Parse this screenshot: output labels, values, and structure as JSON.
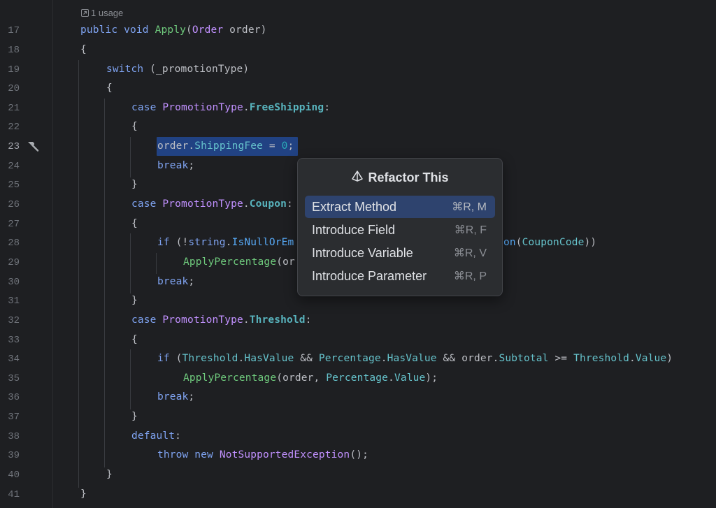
{
  "usage_hint": "1 usage",
  "lines": [
    {
      "n": "17"
    },
    {
      "n": "18"
    },
    {
      "n": "19"
    },
    {
      "n": "20"
    },
    {
      "n": "21"
    },
    {
      "n": "22"
    },
    {
      "n": "23"
    },
    {
      "n": "24"
    },
    {
      "n": "25"
    },
    {
      "n": "26"
    },
    {
      "n": "27"
    },
    {
      "n": "28"
    },
    {
      "n": "29"
    },
    {
      "n": "30"
    },
    {
      "n": "31"
    },
    {
      "n": "32"
    },
    {
      "n": "33"
    },
    {
      "n": "34"
    },
    {
      "n": "35"
    },
    {
      "n": "36"
    },
    {
      "n": "37"
    },
    {
      "n": "38"
    },
    {
      "n": "39"
    },
    {
      "n": "40"
    },
    {
      "n": "41"
    }
  ],
  "code": {
    "l17": {
      "kw1": "public",
      "kw2": "void",
      "method": "Apply",
      "paren_open": "(",
      "type": "Order",
      "param": " order)"
    },
    "l18": "{",
    "l19": {
      "kw": "switch",
      "rest": " (_promotionType)"
    },
    "l20": "{",
    "l21": {
      "kw": "case",
      "type": "PromotionType",
      "dot": ".",
      "member": "FreeShipping",
      "colon": ":"
    },
    "l22": "{",
    "l23": {
      "obj": "order",
      "dot": ".",
      "prop": "ShippingFee",
      "eq": " = ",
      "num": "0",
      "semi": ";"
    },
    "l24": {
      "kw": "break",
      "semi": ";"
    },
    "l25": "}",
    "l26": {
      "kw": "case",
      "type": "PromotionType",
      "dot": ".",
      "member": "Coupon",
      "colon": ":"
    },
    "l27": "{",
    "l28": {
      "kw": "if",
      "p1": " (!",
      "kw2": "string",
      "dot": ".",
      "method": "IsNullOrEm",
      "tail_method": "on",
      "tail_open": "(",
      "tail_prop": "CouponCode",
      "tail_close": "))"
    },
    "l29": {
      "method": "ApplyPercentage",
      "rest": "(or"
    },
    "l30": {
      "kw": "break",
      "semi": ";"
    },
    "l31": "}",
    "l32": {
      "kw": "case",
      "type": "PromotionType",
      "dot": ".",
      "member": "Threshold",
      "colon": ":"
    },
    "l33": "{",
    "l34": {
      "kw": "if",
      "p1": " (",
      "a": "Threshold",
      "d1": ".",
      "b": "HasValue",
      "and1": " && ",
      "c": "Percentage",
      "d2": ".",
      "e": "HasValue",
      "and2": " && ",
      "f": "order",
      "d3": ".",
      "g": "Subtotal",
      "ge": " >= ",
      "h": "Threshold",
      "d4": ".",
      "i": "Value",
      "close": ")"
    },
    "l35": {
      "method": "ApplyPercentage",
      "open": "(order, ",
      "prop": "Percentage",
      "dot": ".",
      "prop2": "Value",
      "close": ");"
    },
    "l36": {
      "kw": "break",
      "semi": ";"
    },
    "l37": "}",
    "l38": {
      "kw": "default",
      "colon": ":"
    },
    "l39": {
      "kw1": "throw",
      "kw2": "new",
      "type": "NotSupportedException",
      "rest": "();"
    },
    "l40": "}",
    "l41": "}"
  },
  "popup": {
    "title": "Refactor This",
    "title_icon": "refactor-prism-icon",
    "items": [
      {
        "label": "Extract Method",
        "shortcut": "⌘R, M",
        "selected": true
      },
      {
        "label": "Introduce Field",
        "shortcut": "⌘R, F",
        "selected": false
      },
      {
        "label": "Introduce Variable",
        "shortcut": "⌘R, V",
        "selected": false
      },
      {
        "label": "Introduce Parameter",
        "shortcut": "⌘R, P",
        "selected": false
      }
    ]
  },
  "gutter_icon": "hammer-icon",
  "colors": {
    "background": "#1e1f22",
    "keyword": "#7fa3f1",
    "type": "#c191ff",
    "method": "#57aaf7",
    "member": "#66c3cc",
    "selection": "#214283",
    "popup_bg": "#2b2d30",
    "popup_selected": "#2e436e"
  }
}
